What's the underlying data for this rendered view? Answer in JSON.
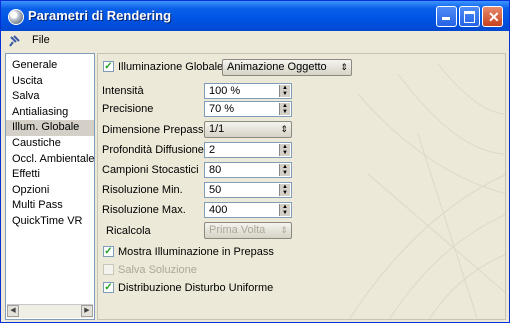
{
  "window": {
    "title": "Parametri di Rendering"
  },
  "menu": {
    "file_label": "File"
  },
  "sidebar": {
    "items": [
      "Generale",
      "Uscita",
      "Salva",
      "Antialiasing",
      "Illum. Globale",
      "Caustiche",
      "Occl. Ambientale",
      "Effetti",
      "Opzioni",
      "Multi Pass",
      "QuickTime VR"
    ],
    "selected": "Illum. Globale"
  },
  "panel": {
    "gi_checkbox_label": "Illuminazione Globale",
    "gi_mode": "Animazione Oggetto",
    "intensity": {
      "label": "Intensità",
      "value": "100 %"
    },
    "precision": {
      "label": "Precisione",
      "value": "70 %"
    },
    "prepass_size": {
      "label": "Dimensione Prepass",
      "value": "1/1"
    },
    "diffusion_depth": {
      "label": "Profondità Diffusione",
      "value": "2"
    },
    "stochastic_samples": {
      "label": "Campioni Stocastici",
      "value": "80"
    },
    "min_resolution": {
      "label": "Risoluzione Min.",
      "value": "50"
    },
    "max_resolution": {
      "label": "Risoluzione Max.",
      "value": "400"
    },
    "recalc": {
      "label": "Ricalcola",
      "value": "Prima Volta"
    },
    "show_prepass": {
      "label": "Mostra Illuminazione in Prepass",
      "checked": true
    },
    "save_solution": {
      "label": "Salva Soluzione",
      "checked": false,
      "disabled": true
    },
    "uniform_noise": {
      "label": "Distribuzione Disturbo Uniforme",
      "checked": true
    }
  }
}
